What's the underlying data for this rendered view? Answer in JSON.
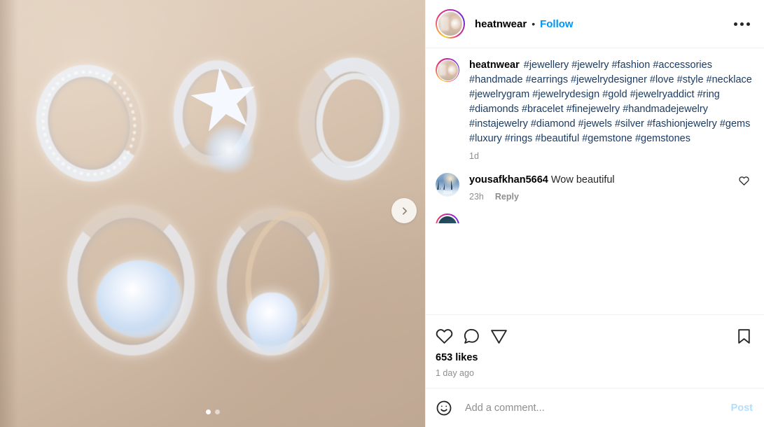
{
  "media": {
    "alt": "Five silver diamond rings arranged on a beige surface",
    "next_slide_icon": "chevron-right-icon",
    "dots": [
      {
        "active": true
      },
      {
        "active": false
      }
    ]
  },
  "header": {
    "avatar_name": "heatnwear-avatar",
    "username": "heatnwear",
    "separator": "•",
    "follow_label": "Follow",
    "more_options_icon": "ellipsis-icon"
  },
  "caption": {
    "author": "heatnwear",
    "text": "#jewellery #jewelry #fashion #accessories #handmade #earrings #jewelrydesigner #love #style #necklace #jewelrygram #jewelrydesign #gold #jewelryaddict #ring #diamonds #bracelet #finejewelry #handmadejewelry #instajewelry #diamond #jewels #silver #fashionjewelry #gems #luxury #rings #beautiful #gemstone #gemstones",
    "timestamp": "1d"
  },
  "comments": [
    {
      "author": "yousafkhan5664",
      "text": "Wow beautiful",
      "timestamp": "23h",
      "reply_label": "Reply",
      "like_icon": "heart-icon"
    }
  ],
  "actions": {
    "like_icon": "heart-icon",
    "comment_icon": "speech-bubble-icon",
    "share_icon": "paper-plane-icon",
    "save_icon": "bookmark-icon",
    "likes_count": "653 likes",
    "post_time": "1 day ago"
  },
  "add_comment": {
    "emoji_icon": "smiley-face-icon",
    "placeholder": "Add a comment...",
    "value": "",
    "post_label": "Post"
  },
  "colors": {
    "link_blue": "#0095f6",
    "post_disabled_blue": "#b2dffc",
    "hashtag_blue": "#1b3c63",
    "muted_gray": "#8e8e8e",
    "divider": "#efefef"
  }
}
